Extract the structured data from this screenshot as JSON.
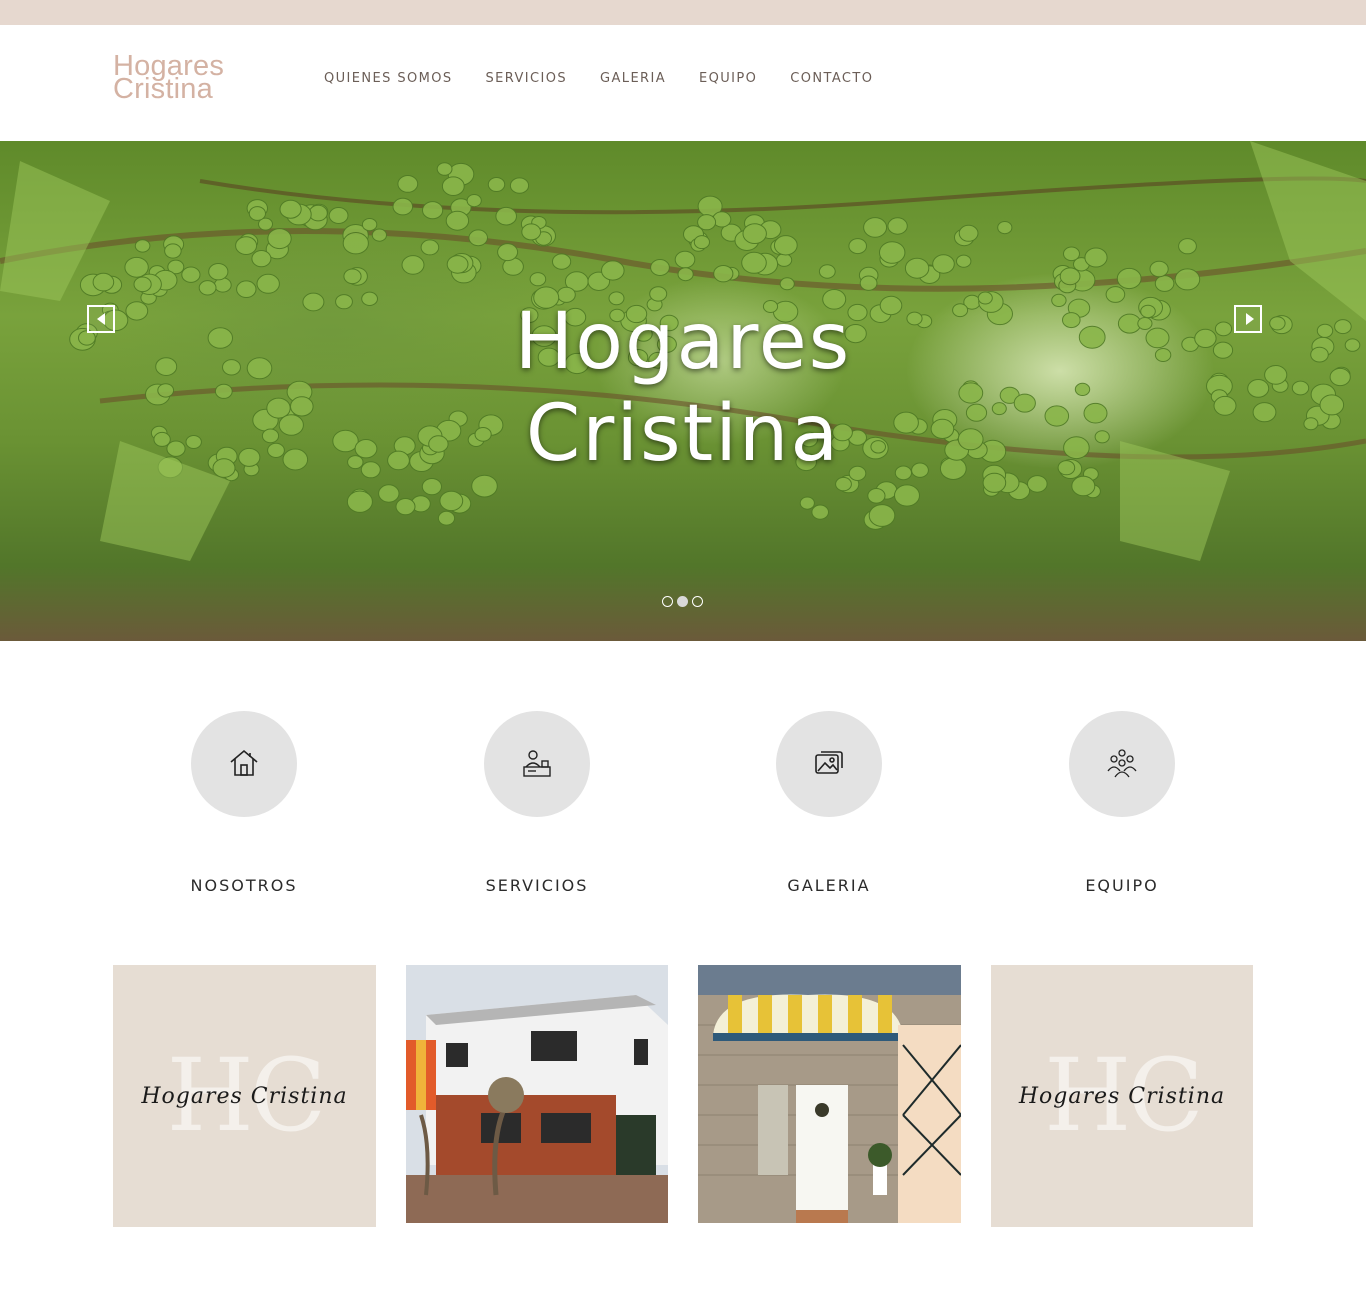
{
  "brand": {
    "line1": "Hogares",
    "line2": "Cristina",
    "color": "#d4b2a3"
  },
  "nav": [
    {
      "label": "QUIENES SOMOS"
    },
    {
      "label": "SERVICIOS"
    },
    {
      "label": "GALERIA"
    },
    {
      "label": "EQUIPO"
    },
    {
      "label": "CONTACTO"
    }
  ],
  "hero": {
    "title_line1": "Hogares",
    "title_line2": "Cristina",
    "prev_icon": "caret-left-icon",
    "next_icon": "caret-right-icon",
    "slides_count": 3,
    "active_slide": 2
  },
  "features": [
    {
      "label": "NOSOTROS",
      "icon": "house-icon"
    },
    {
      "label": "SERVICIOS",
      "icon": "reception-desk-icon"
    },
    {
      "label": "GALERIA",
      "icon": "photo-gallery-icon"
    },
    {
      "label": "EQUIPO",
      "icon": "team-icon"
    }
  ],
  "tiles": [
    {
      "kind": "logo",
      "monogram": "HC",
      "script": "Hogares Cristina"
    },
    {
      "kind": "photo",
      "subject": "white two-storey house with brick facade"
    },
    {
      "kind": "photo",
      "subject": "stone house entrance with striped awning"
    },
    {
      "kind": "logo",
      "monogram": "HC",
      "script": "Hogares Cristina"
    }
  ],
  "colors": {
    "topbar": "#e6d8cf",
    "nav_text": "#6b5e57",
    "circle": "#e3e3e3",
    "tile_bg": "#e6ddd3"
  }
}
